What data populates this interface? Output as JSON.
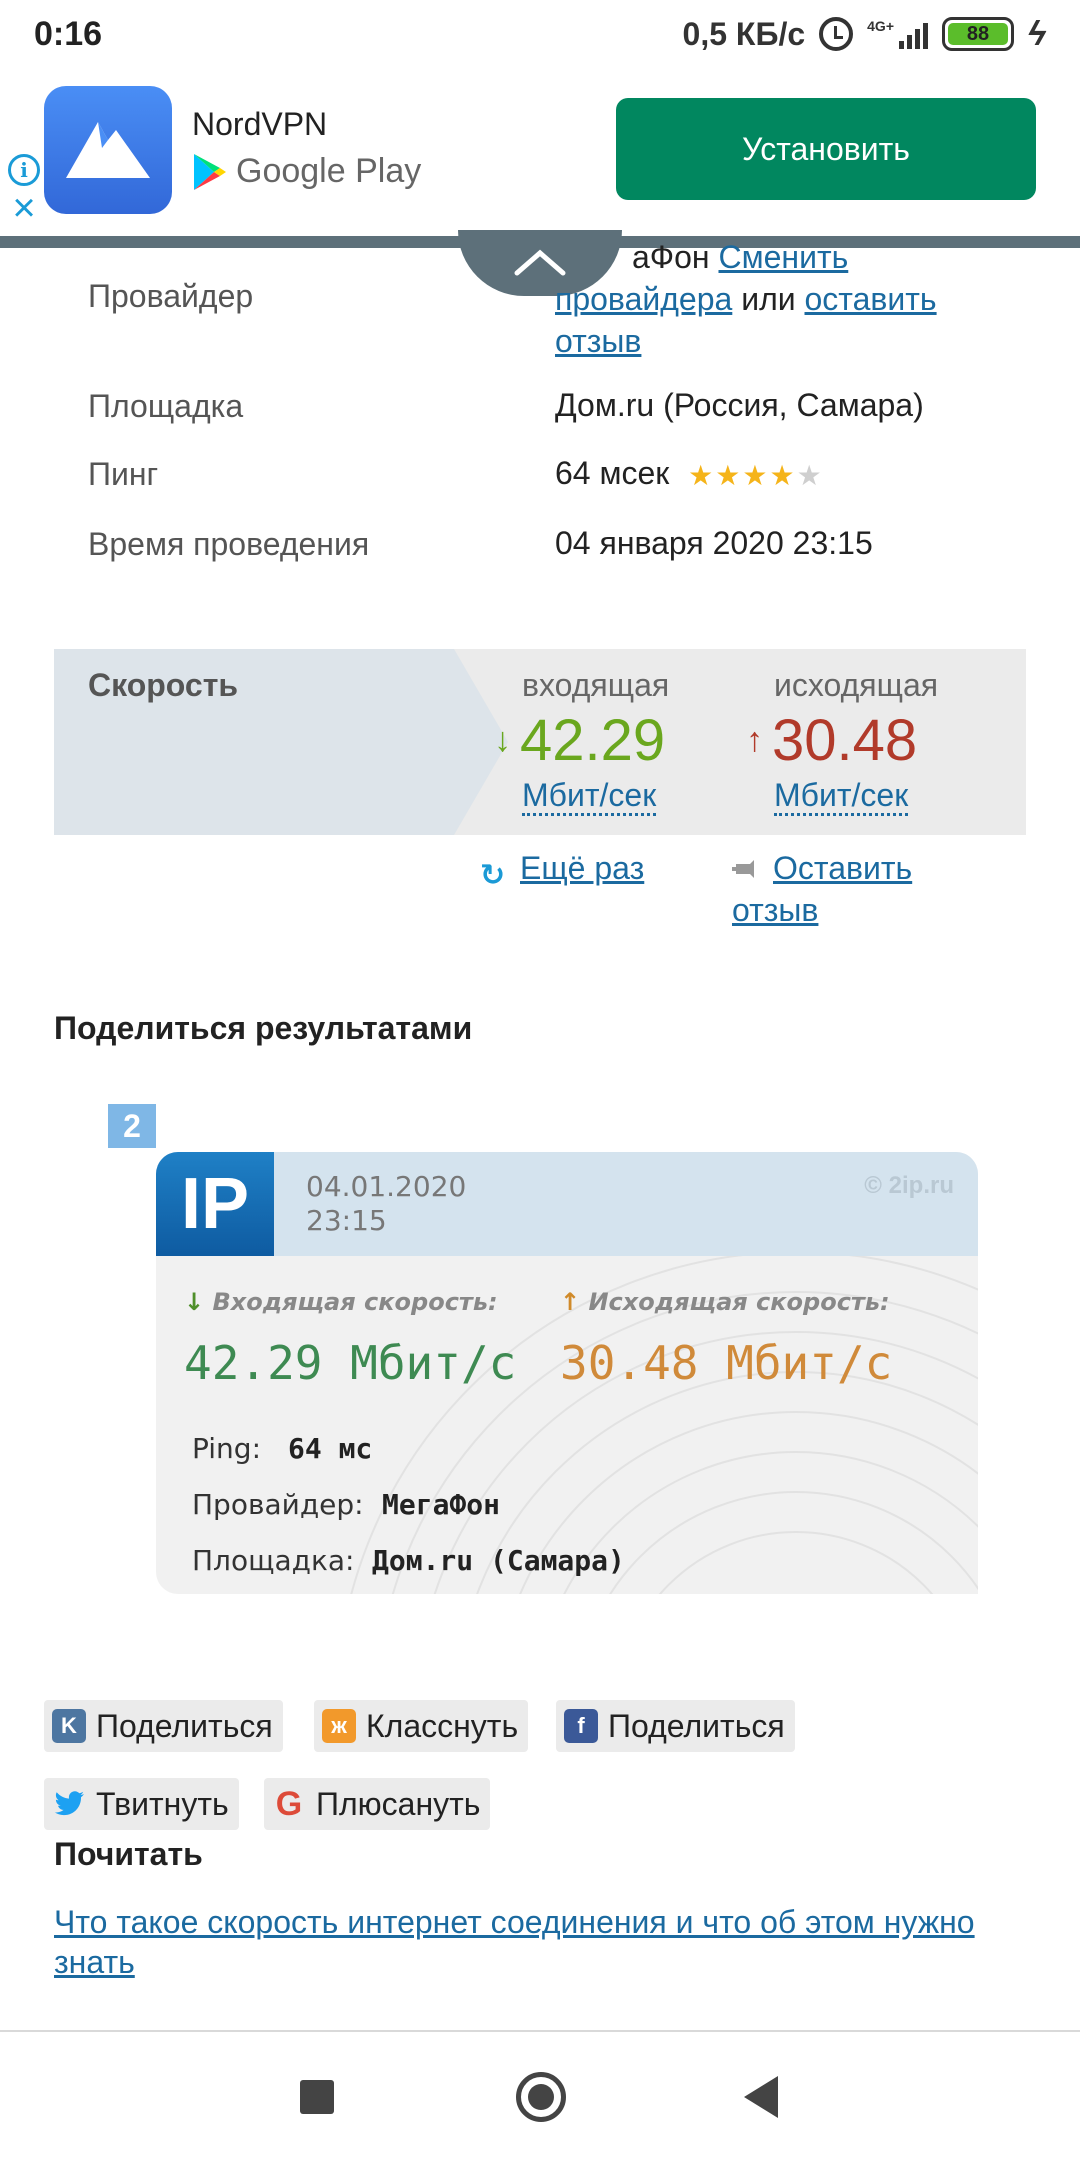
{
  "status_bar": {
    "time": "0:16",
    "net_speed": "0,5 КБ/с",
    "network_type": "4G+",
    "battery": "88",
    "icons": [
      "alarm-icon",
      "signal-icon",
      "battery-icon",
      "charging-icon"
    ]
  },
  "ad": {
    "app_name": "NordVPN",
    "store": "Google Play",
    "install_label": "Установить",
    "install_color": "#01875f"
  },
  "info": {
    "provider_label": "Провайдер",
    "provider_value_partial": "аФон",
    "provider_change_link": "Сменить",
    "provider_change_link2": "провайдера",
    "provider_or": "или",
    "provider_review_link": "оставить",
    "provider_review_link2": "отзыв",
    "site_label": "Площадка",
    "site_value": "Дом.ru (Россия, Самара)",
    "ping_label": "Пинг",
    "ping_value": "64 мсек",
    "ping_rating": 4,
    "ping_rating_max": 5,
    "time_label": "Время проведения",
    "time_value": "04 января 2020 23:15"
  },
  "speed": {
    "title": "Скорость",
    "in_label": "входящая",
    "out_label": "исходящая",
    "in_value": "42.29",
    "out_value": "30.48",
    "in_unit": "Мбит/сек",
    "out_unit": "Мбит/сек",
    "in_color": "#6aa71e",
    "out_color": "#b13a2a",
    "retry_label": "Ещё раз",
    "feedback_label": "Оставить",
    "feedback_label2": "отзыв"
  },
  "share": {
    "title": "Поделиться результатами",
    "card": {
      "badge": "2",
      "logo": "IP",
      "date": "04.01.2020",
      "time": "23:15",
      "watermark": "© 2ip.ru",
      "in_head": "Входящая скорость:",
      "out_head": "Исходящая скорость:",
      "in_value": "42.29 Мбит/с",
      "out_value": "30.48 Мбит/с",
      "ping_label": "Ping:",
      "ping_value": "64 мс",
      "provider_label": "Провайдер:",
      "provider_value": "МегаФон",
      "site_label": "Площадка:",
      "site_value": "Дом.ru (Самара)"
    },
    "buttons": {
      "vk": "Поделиться",
      "ok": "Класснуть",
      "fb": "Поделиться",
      "tw": "Твитнуть",
      "gp": "Плюсануть"
    }
  },
  "read": {
    "title": "Почитать",
    "link": "Что такое скорость интернет соединения и что об этом нужно знать"
  }
}
